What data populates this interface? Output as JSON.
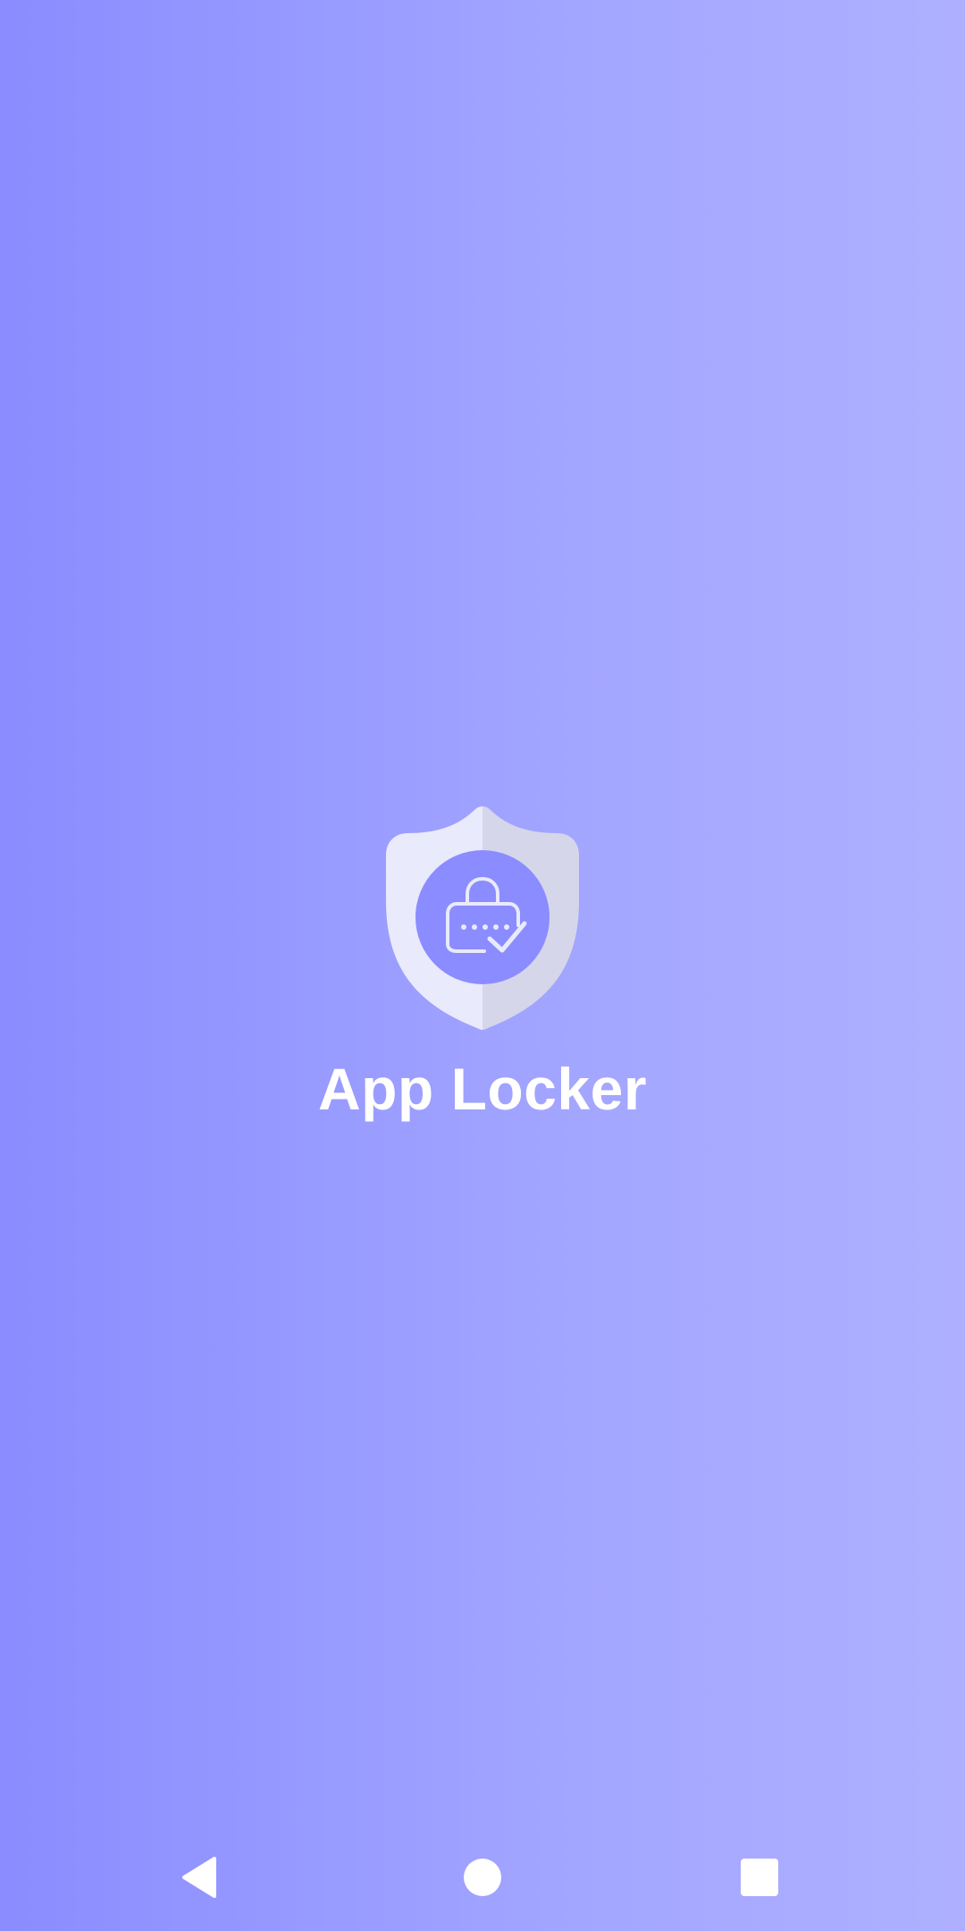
{
  "splash": {
    "app_name": "App Locker",
    "logo_icon": "shield-lock-icon"
  },
  "navigation_bar": {
    "back_icon": "back-triangle-icon",
    "home_icon": "home-circle-icon",
    "recents_icon": "recents-square-icon"
  },
  "colors": {
    "background_start": "#8a8cff",
    "background_end": "#aeb0ff",
    "shield_light": "#e9eafb",
    "shield_shade": "#d5d6ea",
    "inner_circle": "#8a8cff",
    "text": "#ffffff"
  }
}
